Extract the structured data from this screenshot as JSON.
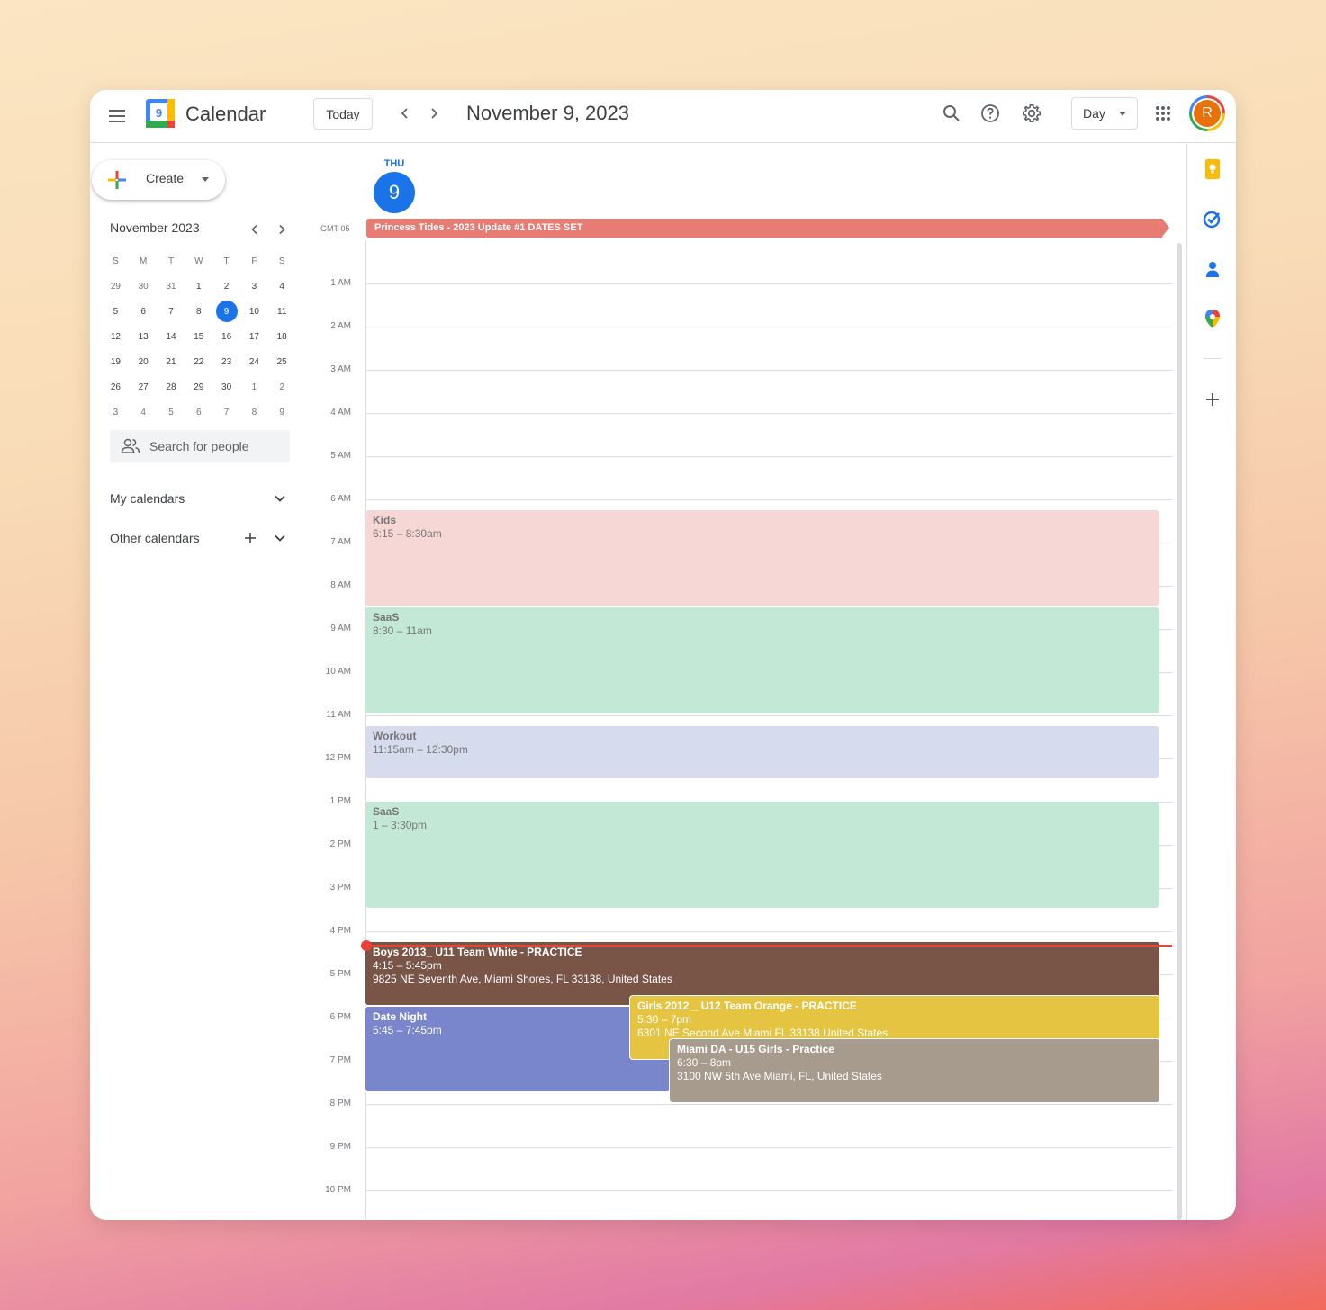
{
  "app": {
    "title": "Calendar",
    "logo_day": "9"
  },
  "header": {
    "today_label": "Today",
    "date_title": "November 9, 2023",
    "view_label": "Day",
    "avatar_initial": "R"
  },
  "sidebar": {
    "create_label": "Create",
    "mini_calendar": {
      "title": "November 2023",
      "weekdays": [
        "S",
        "M",
        "T",
        "W",
        "T",
        "F",
        "S"
      ],
      "weeks": [
        [
          "29",
          "30",
          "31",
          "1",
          "2",
          "3",
          "4"
        ],
        [
          "5",
          "6",
          "7",
          "8",
          "9",
          "10",
          "11"
        ],
        [
          "12",
          "13",
          "14",
          "15",
          "16",
          "17",
          "18"
        ],
        [
          "19",
          "20",
          "21",
          "22",
          "23",
          "24",
          "25"
        ],
        [
          "26",
          "27",
          "28",
          "29",
          "30",
          "1",
          "2"
        ],
        [
          "3",
          "4",
          "5",
          "6",
          "7",
          "8",
          "9"
        ]
      ],
      "selected": "9"
    },
    "search_placeholder": "Search for people",
    "my_calendars_label": "My calendars",
    "other_calendars_label": "Other calendars"
  },
  "day": {
    "weekday": "THU",
    "date": "9",
    "timezone": "GMT-05"
  },
  "allday_event": {
    "title": "Princess Tides - 2023 Update #1 DATES SET",
    "color": "#e67c73"
  },
  "hours": [
    "1 AM",
    "2 AM",
    "3 AM",
    "4 AM",
    "5 AM",
    "6 AM",
    "7 AM",
    "8 AM",
    "9 AM",
    "10 AM",
    "11 AM",
    "12 PM",
    "1 PM",
    "2 PM",
    "3 PM",
    "4 PM",
    "5 PM",
    "6 PM",
    "7 PM",
    "8 PM",
    "9 PM",
    "10 PM"
  ],
  "events": {
    "kids": {
      "title": "Kids",
      "time": "6:15 – 8:30am",
      "color": "#f6d7d5"
    },
    "saas1": {
      "title": "SaaS",
      "time": "8:30 – 11am",
      "color": "#c3e8d6"
    },
    "workout": {
      "title": "Workout",
      "time": "11:15am – 12:30pm",
      "color": "#d6dbee"
    },
    "saas2": {
      "title": "SaaS",
      "time": "1 – 3:30pm",
      "color": "#c3e8d6"
    },
    "boys": {
      "title": "Boys 2013_ U11 Team White - PRACTICE",
      "time": "4:15 – 5:45pm",
      "location": "9825 NE Seventh Ave, Miami Shores, FL 33138, United States",
      "color": "#795548"
    },
    "date_night": {
      "title": "Date Night",
      "time": "5:45 – 7:45pm",
      "color": "#7986cb"
    },
    "girls": {
      "title": "Girls 2012 _ U12 Team Orange - PRACTICE",
      "time": "5:30 – 7pm",
      "location": "6301 NE Second Ave Miami FL 33138 United States",
      "color": "#e4c441"
    },
    "miami": {
      "title": "Miami DA - U15 Girls - Practice",
      "time": "6:30 – 8pm",
      "location": "3100 NW 5th Ave Miami, FL, United States",
      "color": "#a79b8e"
    }
  },
  "colors": {
    "accent": "#1a73e8",
    "now_indicator": "#ea4335"
  }
}
